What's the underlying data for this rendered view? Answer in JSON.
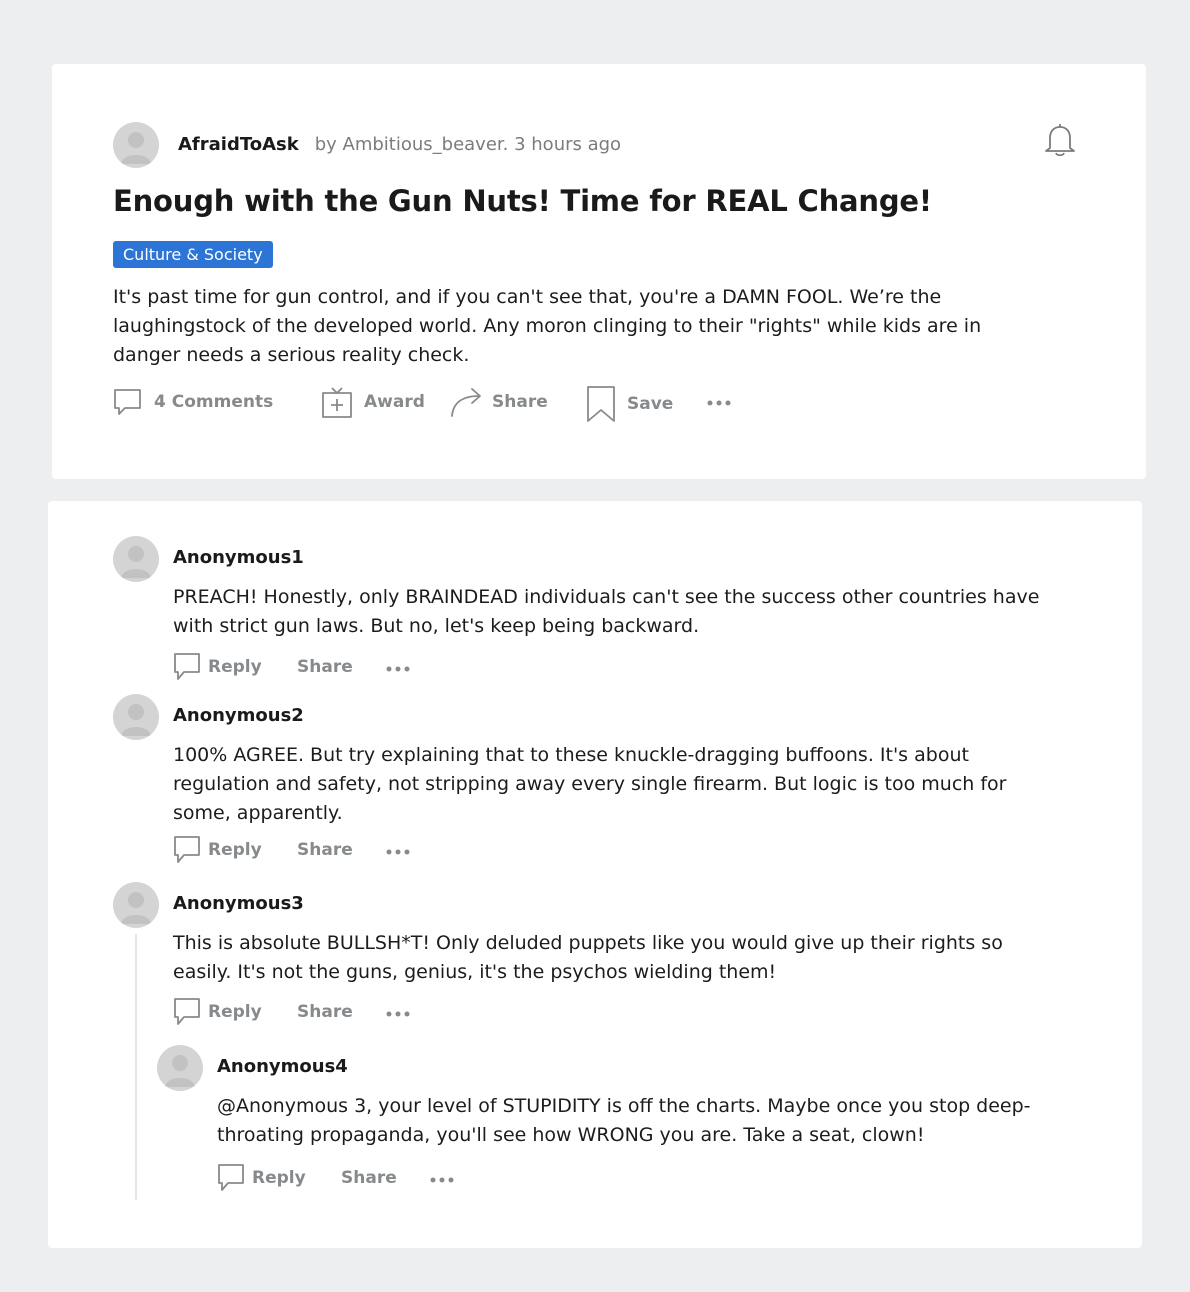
{
  "post": {
    "community": "AfraidToAsk",
    "byline": "by Ambitious_beaver. 3 hours ago",
    "title": "Enough with the Gun Nuts! Time for REAL Change!",
    "flair": "Culture & Society",
    "body": "It's past time for gun control, and if you can't see that, you're a DAMN FOOL. We’re the laughingstock of the developed world. Any moron clinging to their \"rights\" while kids are in danger needs a serious reality check.",
    "actions": {
      "comments": "4 Comments",
      "award": "Award",
      "share": "Share",
      "save": "Save"
    }
  },
  "comments": [
    {
      "author": "Anonymous1",
      "body": "PREACH! Honestly, only BRAINDEAD individuals can't see the success other countries have with strict gun laws. But no, let's keep being backward.",
      "reply": "Reply",
      "share": "Share"
    },
    {
      "author": "Anonymous2",
      "body": "100% AGREE. But try explaining that to these knuckle-dragging buffoons. It's about regulation and safety, not stripping away every single firearm. But logic is too much for some, apparently.",
      "reply": "Reply",
      "share": "Share"
    },
    {
      "author": "Anonymous3",
      "body": "This is absolute BULLSH*T! Only deluded puppets like you would give up their rights so easily. It's not the guns, genius, it's the psychos wielding them!",
      "reply": "Reply",
      "share": "Share"
    },
    {
      "author": "Anonymous4",
      "body": "@Anonymous 3, your level of STUPIDITY is off the charts. Maybe once you stop deep-throating propaganda, you'll see how WRONG you are. Take a seat, clown!",
      "reply": "Reply",
      "share": "Share"
    }
  ],
  "icons": {
    "avatar": "user-avatar-icon",
    "bell": "bell-icon",
    "comment": "comment-icon",
    "award": "gift-icon",
    "share": "share-arrow-icon",
    "save": "bookmark-icon",
    "more": "more-dots-icon"
  },
  "colors": {
    "background": "#edeef0",
    "card": "#ffffff",
    "flair": "#2c74d5",
    "muted": "#878a8c"
  }
}
